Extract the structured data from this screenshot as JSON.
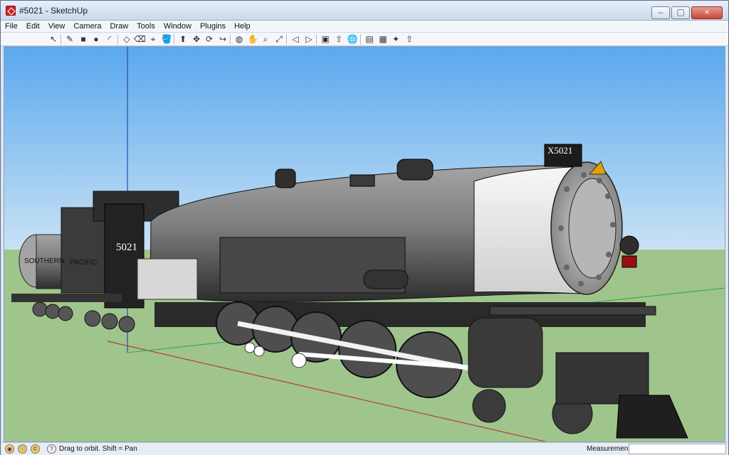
{
  "window": {
    "title": "#5021 - SketchUp",
    "minimize_symbol": "–",
    "maximize_symbol": "▢",
    "close_symbol": "×"
  },
  "menu": [
    "File",
    "Edit",
    "View",
    "Camera",
    "Draw",
    "Tools",
    "Window",
    "Plugins",
    "Help"
  ],
  "toolbar": {
    "tools": [
      "select-icon",
      "pencil-icon",
      "rectangle-icon",
      "circle-icon",
      "arc-icon",
      "make-component-icon",
      "eraser-icon",
      "tape-measure-icon",
      "paint-bucket-icon",
      "push-pull-icon",
      "move-icon",
      "rotate-icon",
      "follow-me-icon",
      "orbit-icon",
      "pan-icon",
      "zoom-icon",
      "zoom-extents-icon",
      "previous-view-icon",
      "next-view-icon",
      "get-models-icon",
      "share-model-icon",
      "google-earth-icon",
      "extension-warehouse-icon",
      "layout-icon",
      "style-builder-icon",
      "share-component-icon"
    ],
    "tool_symbols": [
      "↖",
      "✎",
      "■",
      "●",
      "◜",
      "◇",
      "⌫",
      "⌖",
      "🪣",
      "⬆",
      "✥",
      "⟳",
      "↪",
      "◍",
      "✋",
      "⌕",
      "⤢",
      "◁",
      "▷",
      "▣",
      "⇪",
      "🌐",
      "▤",
      "▦",
      "✦",
      "⇧"
    ]
  },
  "scene": {
    "engine_number_plate": "X5021",
    "cab_number": "5021",
    "tender_road_name_1": "SOUTHERN",
    "tender_road_name_2": "PACIFIC",
    "sky_color": "#86b9ea",
    "ground_color": "#9cc08e"
  },
  "status": {
    "icons": [
      "geo-location-icon",
      "credits-icon",
      "info-icon",
      "help-icon"
    ],
    "message": "Drag to orbit.  Shift = Pan",
    "measurements_label": "Measurements",
    "measurements_value": ""
  }
}
